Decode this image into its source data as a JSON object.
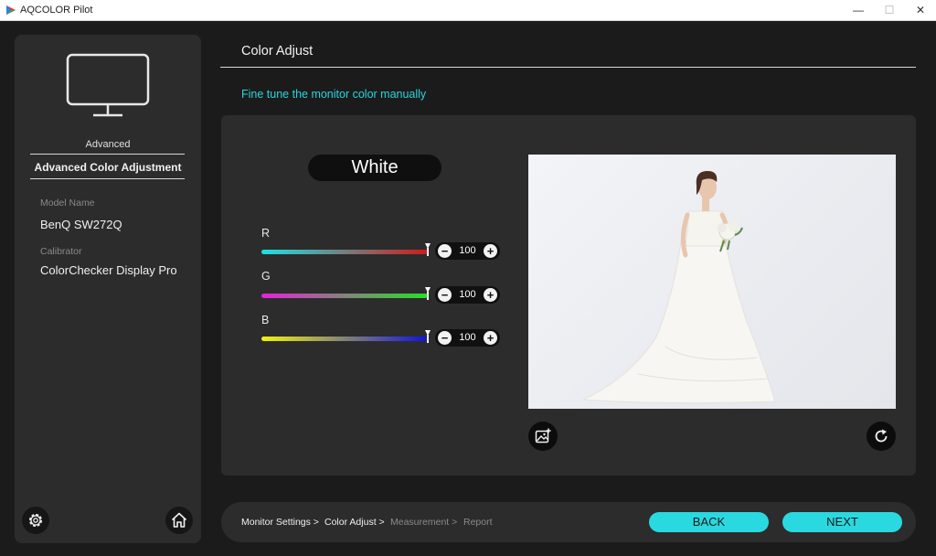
{
  "window": {
    "title": "AQCOLOR Pilot",
    "minimize": "—",
    "maximize": "☐",
    "close": "✕"
  },
  "sidebar": {
    "section": "Advanced",
    "active_item": "Advanced Color Adjustment",
    "model_label": "Model Name",
    "model_value": "BenQ SW272Q",
    "calibrator_label": "Calibrator",
    "calibrator_value": "ColorChecker Display Pro",
    "settings_icon": "gear-icon",
    "home_icon": "home-icon"
  },
  "main": {
    "title": "Color Adjust",
    "subtitle": "Fine tune the monitor color manually",
    "mode": "White",
    "channels": [
      {
        "label": "R",
        "value": "100",
        "fraction": 1.0
      },
      {
        "label": "G",
        "value": "100",
        "fraction": 1.0
      },
      {
        "label": "B",
        "value": "100",
        "fraction": 1.0
      }
    ],
    "preview_icon_left": "add-image-icon",
    "preview_icon_right": "reset-icon"
  },
  "footer": {
    "breadcrumb": [
      "Monitor Settings >",
      "Color Adjust >",
      "Measurement >",
      "Report"
    ],
    "back_label": "BACK",
    "next_label": "NEXT"
  },
  "colors": {
    "accent": "#2ad9e0",
    "panel": "#2c2c2c",
    "background": "#1b1b1b"
  }
}
